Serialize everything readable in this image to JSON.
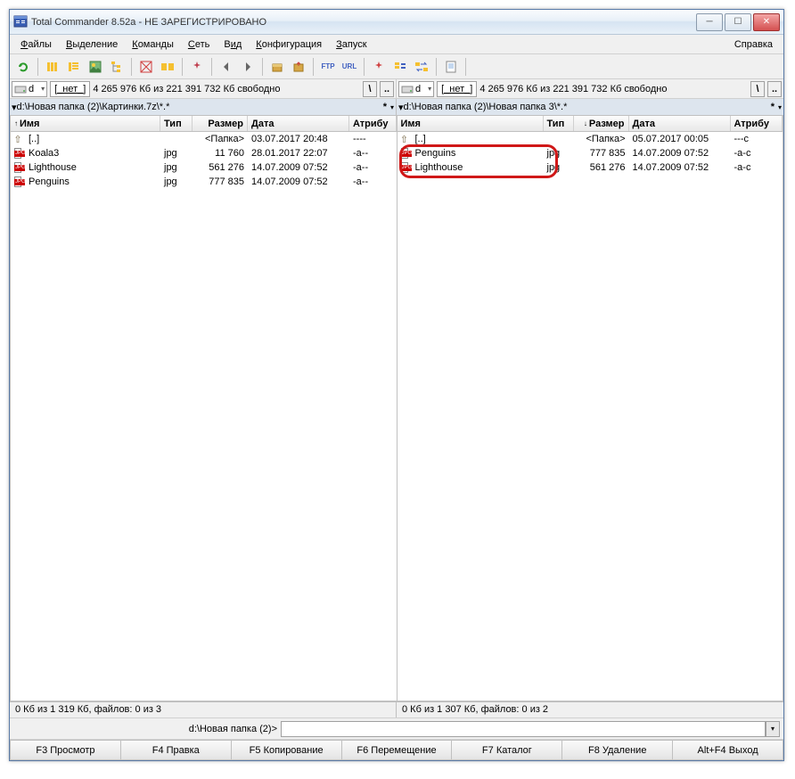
{
  "title": "Total Commander 8.52a - НЕ ЗАРЕГИСТРИРОВАНО",
  "menus": {
    "files": "Файлы",
    "selection": "Выделение",
    "commands": "Команды",
    "net": "Сеть",
    "view": "Вид",
    "config": "Конфигурация",
    "run": "Запуск",
    "help": "Справка"
  },
  "drive": {
    "letter": "d",
    "label": "[_нет_]",
    "info": "4 265 976 Кб из 221 391 732 Кб свободно"
  },
  "rootbtns": {
    "root": "\\",
    "up": ".."
  },
  "paths": {
    "left": "d:\\Новая папка (2)\\Картинки.7z\\*.*",
    "right": "d:\\Новая папка (2)\\Новая папка 3\\*.*"
  },
  "columns": {
    "name": "Имя",
    "type": "Тип",
    "size": "Размер",
    "date": "Дата",
    "attr": "Атрибу"
  },
  "left": {
    "rows": [
      {
        "icon": "up",
        "name": "[..]",
        "type": "",
        "size": "<Папка>",
        "date": "03.07.2017 20:48",
        "attr": "----"
      },
      {
        "icon": "jpg",
        "name": "Koala3",
        "type": "jpg",
        "size": "11 760",
        "date": "28.01.2017 22:07",
        "attr": "-a--"
      },
      {
        "icon": "jpg",
        "name": "Lighthouse",
        "type": "jpg",
        "size": "561 276",
        "date": "14.07.2009 07:52",
        "attr": "-a--"
      },
      {
        "icon": "jpg",
        "name": "Penguins",
        "type": "jpg",
        "size": "777 835",
        "date": "14.07.2009 07:52",
        "attr": "-a--"
      }
    ],
    "status": "0 Кб из 1 319 Кб, файлов: 0 из 3"
  },
  "right": {
    "rows": [
      {
        "icon": "up",
        "name": "[..]",
        "type": "",
        "size": "<Папка>",
        "date": "05.07.2017 00:05",
        "attr": "---с"
      },
      {
        "icon": "jpg",
        "name": "Penguins",
        "type": "jpg",
        "size": "777 835",
        "date": "14.07.2009 07:52",
        "attr": "-a-с"
      },
      {
        "icon": "jpg",
        "name": "Lighthouse",
        "type": "jpg",
        "size": "561 276",
        "date": "14.07.2009 07:52",
        "attr": "-a-с"
      }
    ],
    "status": "0 Кб из 1 307 Кб, файлов: 0 из 2"
  },
  "cmd": {
    "prompt": "d:\\Новая папка (2)>"
  },
  "fkeys": {
    "f3": "F3 Просмотр",
    "f4": "F4 Правка",
    "f5": "F5 Копирование",
    "f6": "F6 Перемещение",
    "f7": "F7 Каталог",
    "f8": "F8 Удаление",
    "altf4": "Alt+F4 Выход"
  },
  "colw": {
    "left": {
      "name": 168,
      "type": 36,
      "size": 62,
      "date": 114,
      "attr": 48
    },
    "right": {
      "name": 164,
      "type": 34,
      "size": 62,
      "date": 114,
      "attr": 48
    }
  }
}
